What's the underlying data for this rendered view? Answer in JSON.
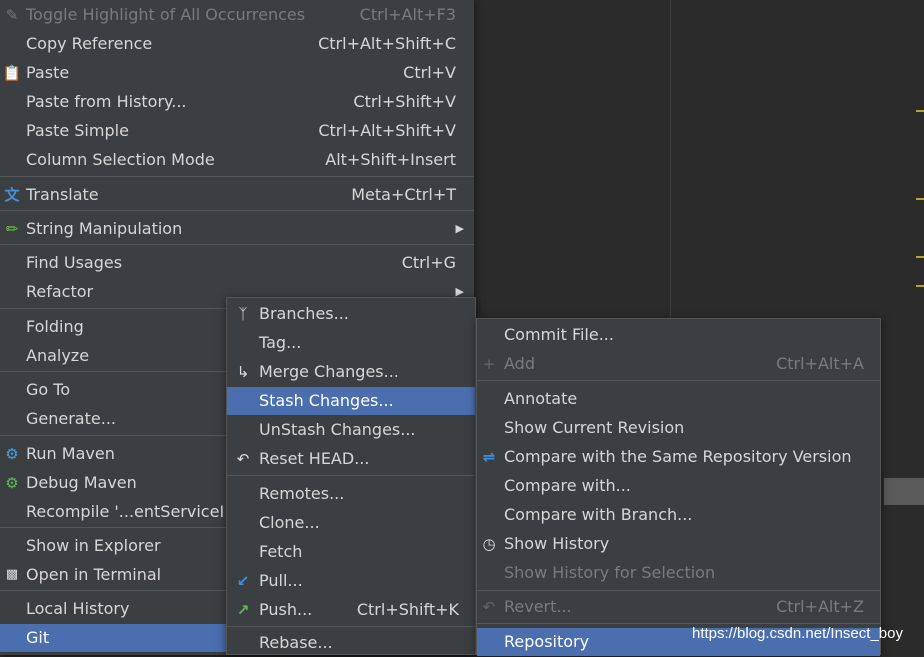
{
  "colors": {
    "menu_bg": "#3c3f41",
    "selection": "#4b6eaf",
    "disabled_text": "#7a7a7a",
    "text": "#d6d6d6",
    "separator": "#515658"
  },
  "context_menu": {
    "items": [
      {
        "label": "Toggle Highlight of All Occurrences",
        "shortcut": "Ctrl+Alt+F3",
        "icon": "highlighter-icon",
        "disabled": true
      },
      {
        "label": "Copy Reference",
        "shortcut": "Ctrl+Alt+Shift+C"
      },
      {
        "label": "Paste",
        "shortcut": "Ctrl+V",
        "icon": "clipboard-icon"
      },
      {
        "label": "Paste from History...",
        "shortcut": "Ctrl+Shift+V"
      },
      {
        "label": "Paste Simple",
        "shortcut": "Ctrl+Alt+Shift+V"
      },
      {
        "label": "Column Selection Mode",
        "shortcut": "Alt+Shift+Insert"
      },
      {
        "label": "Translate",
        "shortcut": "Meta+Ctrl+T",
        "icon": "translate-icon"
      },
      {
        "label": "String Manipulation",
        "icon": "pencil-icon",
        "submenu": true
      },
      {
        "label": "Find Usages",
        "shortcut": "Ctrl+G"
      },
      {
        "label": "Refactor",
        "submenu": true
      },
      {
        "label": "Folding"
      },
      {
        "label": "Analyze"
      },
      {
        "label": "Go To"
      },
      {
        "label": "Generate..."
      },
      {
        "label": "Run Maven",
        "icon": "gear-icon"
      },
      {
        "label": "Debug Maven",
        "icon": "gear-green-icon"
      },
      {
        "label": "Recompile '...entServiceI"
      },
      {
        "label": "Show in Explorer"
      },
      {
        "label": "Open in Terminal",
        "icon": "terminal-icon"
      },
      {
        "label": "Local History"
      },
      {
        "label": "Git"
      }
    ]
  },
  "git_menu": {
    "items": [
      {
        "label": "Branches...",
        "icon": "branch-icon"
      },
      {
        "label": "Tag..."
      },
      {
        "label": "Merge Changes...",
        "icon": "merge-icon"
      },
      {
        "label": "Stash Changes..."
      },
      {
        "label": "UnStash Changes..."
      },
      {
        "label": "Reset HEAD...",
        "icon": "undo-icon"
      },
      {
        "label": "Remotes..."
      },
      {
        "label": "Clone..."
      },
      {
        "label": "Fetch"
      },
      {
        "label": "Pull...",
        "icon": "pull-arrow-icon"
      },
      {
        "label": "Push...",
        "shortcut": "Ctrl+Shift+K",
        "icon": "push-arrow-icon"
      },
      {
        "label": "Rebase..."
      }
    ]
  },
  "repo_menu": {
    "items": [
      {
        "label": "Commit File..."
      },
      {
        "label": "Add",
        "shortcut": "Ctrl+Alt+A",
        "icon": "plus-icon",
        "disabled": true
      },
      {
        "label": "Annotate"
      },
      {
        "label": "Show Current Revision"
      },
      {
        "label": "Compare with the Same Repository Version",
        "icon": "compare-icon"
      },
      {
        "label": "Compare with..."
      },
      {
        "label": "Compare with Branch..."
      },
      {
        "label": "Show History",
        "icon": "clock-icon"
      },
      {
        "label": "Show History for Selection",
        "disabled": true
      },
      {
        "label": "Revert...",
        "shortcut": "Ctrl+Alt+Z",
        "icon": "revert-icon",
        "disabled": true
      },
      {
        "label": "Repository"
      }
    ]
  },
  "watermark": "https://blog.csdn.net/Insect_boy"
}
